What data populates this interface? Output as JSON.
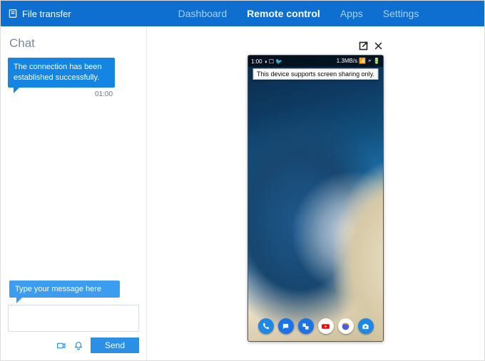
{
  "nav": {
    "file_transfer_label": "File transfer",
    "tabs": [
      "Dashboard",
      "Remote control",
      "Apps",
      "Settings"
    ],
    "active_tab": "Remote control"
  },
  "chat": {
    "title": "Chat",
    "messages": [
      {
        "text": "The connection has been established successfully.",
        "time": "01:00"
      }
    ],
    "hint": "Type your message here",
    "input_value": "",
    "send_label": "Send"
  },
  "phone": {
    "status_left": "1:00 ◑ ☐ 🐦",
    "status_right": "1.3MB/s 📶 🗲 🔋",
    "tooltip": "This device supports screen sharing only.",
    "dock_icons": [
      "phone-icon",
      "messages-icon",
      "translate-icon",
      "youtube-icon",
      "firefox-icon",
      "camera-icon"
    ]
  },
  "window_controls": {
    "popout_icon": "popout-icon",
    "close_icon": "close-icon"
  }
}
